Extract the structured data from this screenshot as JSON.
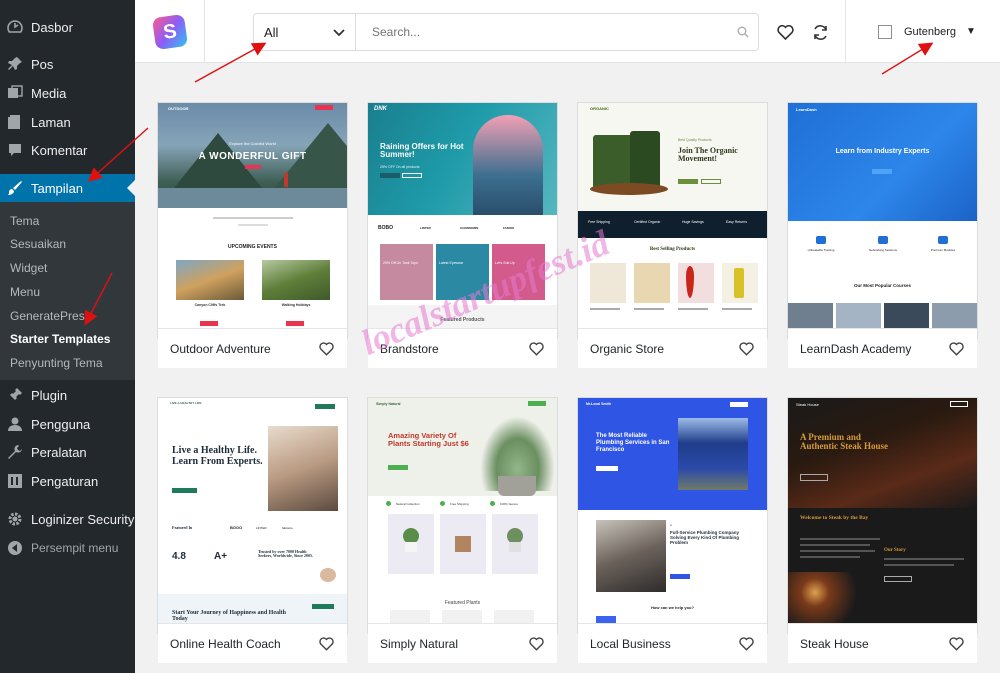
{
  "sidebar": {
    "items": [
      {
        "label": "Dasbor",
        "icon": "dashboard-icon"
      },
      {
        "label": "Pos",
        "icon": "pin-icon"
      },
      {
        "label": "Media",
        "icon": "media-icon"
      },
      {
        "label": "Laman",
        "icon": "page-icon"
      },
      {
        "label": "Komentar",
        "icon": "comment-icon"
      },
      {
        "label": "Tampilan",
        "icon": "brush-icon",
        "active": true
      },
      {
        "label": "Plugin",
        "icon": "plugin-icon"
      },
      {
        "label": "Pengguna",
        "icon": "user-icon"
      },
      {
        "label": "Peralatan",
        "icon": "wrench-icon"
      },
      {
        "label": "Pengaturan",
        "icon": "settings-icon"
      },
      {
        "label": "Loginizer Security",
        "icon": "gear-icon"
      },
      {
        "label": "Persempit menu",
        "icon": "collapse-icon"
      }
    ],
    "submenu": [
      {
        "label": "Tema"
      },
      {
        "label": "Sesuaikan"
      },
      {
        "label": "Widget"
      },
      {
        "label": "Menu"
      },
      {
        "label": "GeneratePress"
      },
      {
        "label": "Starter Templates",
        "current": true
      },
      {
        "label": "Penyunting Tema"
      }
    ]
  },
  "topbar": {
    "logo_letter": "S",
    "category": "All",
    "search_placeholder": "Search...",
    "builder": "Gutenberg"
  },
  "templates": [
    {
      "title": "Outdoor Adventure",
      "preview": {
        "nav_brand": "OUTDOOR",
        "hero": "A WONDERFUL GIFT",
        "hero_sub": "Explore the Colorful World",
        "section": "UPCOMING EVENTS",
        "items": [
          "Canyon Cliffs Trek",
          "Walking Holidays"
        ]
      }
    },
    {
      "title": "Brandstore",
      "preview": {
        "nav_brand": "DNK",
        "hero": "Raining Offers for Hot Summer!",
        "hero_sub": "25% OFF On all products",
        "brands": [
          "BOBO",
          "LINTER",
          "GOODMORN",
          "FADOM"
        ],
        "tiles": [
          "20% Off On Tank Tops",
          "Latest Eyewear",
          "Let's Suit Up"
        ],
        "section": "Featured Products"
      }
    },
    {
      "title": "Organic Store",
      "preview": {
        "nav_brand": "ORGANIC",
        "hero": "Join The Organic Movement!",
        "hero_sub": "Best Quality Products",
        "features": [
          "Free Shipping",
          "Certified Organic",
          "Huge Savings",
          "Easy Returns"
        ],
        "section": "Best Selling Products"
      }
    },
    {
      "title": "LearnDash Academy",
      "preview": {
        "nav_brand": "LearnDash",
        "hero": "Learn from Industry Experts",
        "features": [
          "Unbeatable Training",
          "Networking Sessions",
          "Premium Modules"
        ],
        "section": "Our Most Popular Courses"
      }
    },
    {
      "title": "Online Health Coach",
      "preview": {
        "nav_brand": "LIVE A HEALTHY LIFE",
        "hero": "Live a Healthy Life. Learn From Experts.",
        "featured": "Featured In",
        "logos": [
          "BOOO",
          "LINTER",
          "fabstore"
        ],
        "stat1": "4.8",
        "stat2": "A+",
        "quote": "Trusted by over 7000 Health Seekers, Worldwide, Since 2005.",
        "cta": "Start Your Journey of Happiness and Health Today"
      }
    },
    {
      "title": "Simply Natural",
      "preview": {
        "nav_brand": "Simply Natural",
        "hero": "Amazing Variety Of Plants Starting Just $6",
        "features": [
          "Natural Collection",
          "Free Shipping",
          "100% Secure"
        ],
        "section": "Featured Plants"
      }
    },
    {
      "title": "Local Business",
      "preview": {
        "nav_brand": "Mr.Local Smith",
        "hero": "The Most Reliable Plumbing Services in San Francisco",
        "body_title": "Full-Service Plumbing Company Solving Every Kind Of Plumbing Problem",
        "section": "How can we help you?"
      }
    },
    {
      "title": "Steak House",
      "preview": {
        "nav_brand": "Steak House",
        "hero": "A Premium and Authentic Steak House",
        "welcome": "Welcome to Steak by the Bay",
        "story": "Our Story"
      }
    }
  ],
  "watermark": "localstartupfest.id",
  "colors": {
    "sidebar_bg": "#23282d",
    "submenu_bg": "#32373c",
    "active": "#0073aa",
    "arrow": "#e01010",
    "watermark": "#e678d2"
  }
}
